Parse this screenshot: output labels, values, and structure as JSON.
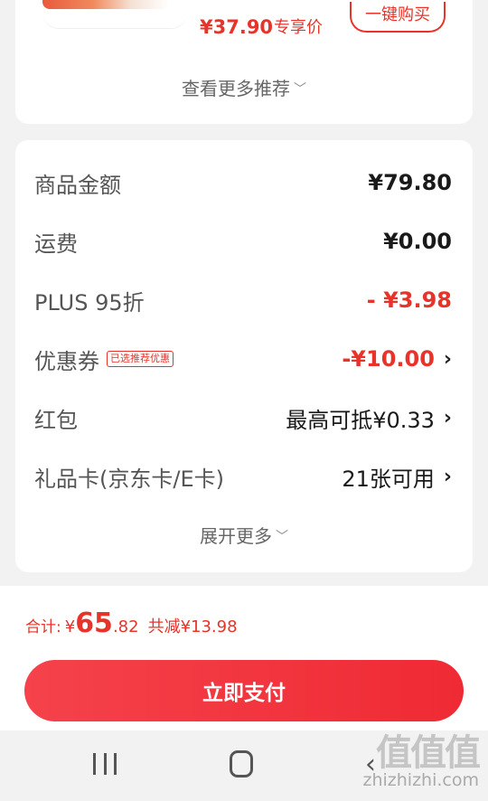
{
  "recommend": {
    "price": "¥37.90",
    "price_tag": "专享价",
    "buy_label": "一键购买",
    "more_label": "查看更多推荐"
  },
  "summary": {
    "rows": [
      {
        "label": "商品金额",
        "value": "¥79.80"
      },
      {
        "label": "运费",
        "value": "¥0.00"
      },
      {
        "label": "PLUS 95折",
        "value": "- ¥3.98"
      },
      {
        "label": "优惠券",
        "badge": "已选推荐优惠",
        "value": "-¥10.00"
      },
      {
        "label": "红包",
        "value": "最高可抵¥0.33"
      },
      {
        "label": "礼品卡(京东卡/E卡)",
        "value": "21张可用"
      }
    ],
    "expand_label": "展开更多"
  },
  "total": {
    "label": "合计:",
    "currency": "¥",
    "integer": "65",
    "decimal": ".82",
    "saved": "共减¥13.98"
  },
  "pay_button": "立即支付",
  "watermark": {
    "title": "值值值",
    "site": "zhizhizhi.com"
  },
  "colors": {
    "accent": "#e8332a",
    "background": "#f2f2f2"
  }
}
